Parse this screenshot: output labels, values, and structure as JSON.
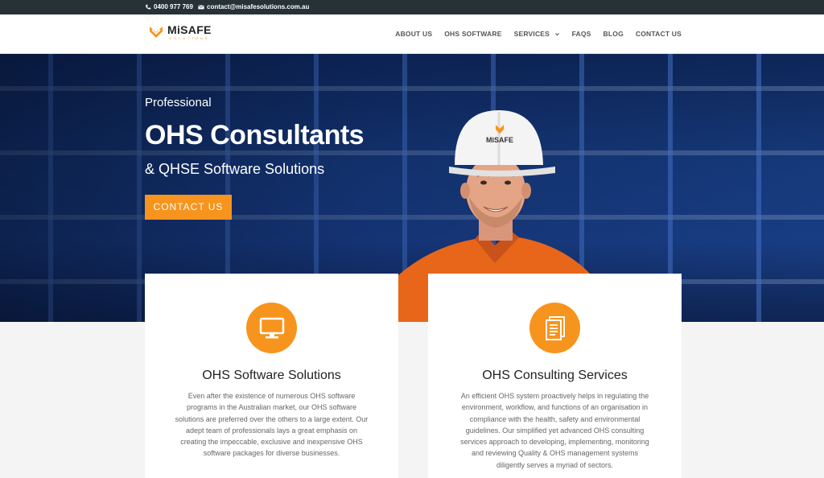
{
  "topbar": {
    "phone": "0400 977 769",
    "email": "contact@misafesolutions.com.au"
  },
  "logo": {
    "word": "MiSAFE",
    "sub": "SOLUTIONS"
  },
  "nav": {
    "items": [
      "ABOUT US",
      "OHS SOFTWARE",
      "SERVICES",
      "FAQS",
      "BLOG",
      "CONTACT US"
    ]
  },
  "hero": {
    "eyebrow": "Professional",
    "title": "OHS Consultants",
    "subtitle": "& QHSE Software Solutions",
    "cta": "CONTACT US",
    "helmet_logo": "MiSAFE"
  },
  "cards": [
    {
      "icon": "monitor-icon",
      "title": "OHS Software Solutions",
      "text": "Even after the existence of numerous OHS software programs in the Australian market, our OHS software solutions are preferred over the others to a large extent. Our adept team of professionals lays a great emphasis on creating the impeccable, exclusive and inexpensive OHS software packages for diverse businesses."
    },
    {
      "icon": "document-icon",
      "title": "OHS Consulting Services",
      "text": "An efficient OHS system proactively helps in regulating the environment, workflow, and functions of an organisation in compliance with the health, safety and environmental guidelines. Our simplified yet advanced OHS consulting services approach to developing, implementing, monitoring and reviewing Quality & OHS management systems diligently serves a myriad of sectors."
    }
  ],
  "colors": {
    "accent": "#f7941d",
    "topbar": "#263238"
  }
}
